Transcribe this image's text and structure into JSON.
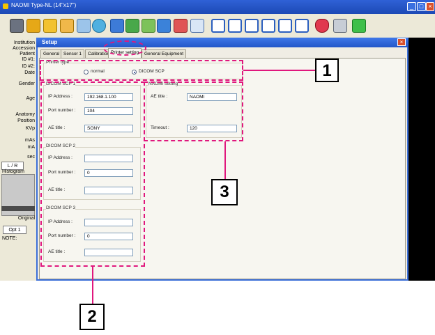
{
  "app": {
    "title": "NAOMI  Type-NL (14\"x17\")",
    "toolbar_icons": [
      "camera-icon",
      "home-icon",
      "folder-icon",
      "folder-open-icon",
      "printer-icon",
      "globe-icon",
      "pencil-icon",
      "transfer-icon",
      "flip-icon",
      "undo-icon",
      "redo-icon",
      "measure-icon",
      "layout-1-icon",
      "layout-2-icon",
      "layout-3-icon",
      "layout-4-icon",
      "layout-5-icon",
      "layout-6-icon",
      "heart-icon",
      "tools-icon",
      "exit-icon"
    ]
  },
  "left_panel": {
    "labels": [
      "Institution",
      "Accession",
      "Patient",
      "ID #1:",
      "ID #2:",
      "Date",
      "Gender",
      "Age",
      "Anatomy",
      "Position",
      "KVp",
      "mAs",
      "mA",
      "sec"
    ],
    "lr_button": "L / R",
    "histogram_label": "Histogram",
    "original_button": "Original",
    "opt_button": "Opt 1",
    "note_label": "NOTE:"
  },
  "dialog": {
    "title": "Setup",
    "tabs": [
      "General",
      "Sensor 1",
      "Calibration",
      "Printer setting",
      "General Equipment"
    ],
    "active_tab": "Printer setting",
    "printer_type": {
      "title": "Printer type",
      "options": [
        "normal",
        "DICOM SCP"
      ],
      "selected": "DICOM SCP"
    },
    "scp1": {
      "title": "DICOM SCP 1",
      "ip_label": "IP Address :",
      "ip_value": "192.168.1.100",
      "port_label": "Port number :",
      "port_value": "104",
      "ae_label": "AE title :",
      "ae_value": "SONY"
    },
    "scp2": {
      "title": "DICOM SCP 2",
      "ip_label": "IP Address :",
      "ip_value": "",
      "port_label": "Port number :",
      "port_value": "0",
      "ae_label": "AE title :",
      "ae_value": ""
    },
    "scp3": {
      "title": "DICOM SCP 3",
      "ip_label": "IP Address :",
      "ip_value": "",
      "port_label": "Port number :",
      "port_value": "0",
      "ae_label": "AE title :",
      "ae_value": ""
    },
    "naomi": {
      "title": "NAOMI setting",
      "ae_label": "AE title :",
      "ae_value": "NAOMI",
      "timeout_label": "Timeout :",
      "timeout_value": "120"
    }
  },
  "annotations": {
    "callout_1": "1",
    "callout_2": "2",
    "callout_3": "3",
    "color": "#e0177d"
  }
}
